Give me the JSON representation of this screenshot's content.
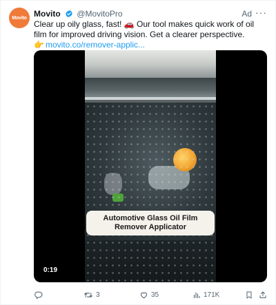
{
  "tweet": {
    "author_name": "Movito",
    "author_handle": "@MovitoPro",
    "avatar_text": "Movito",
    "ad_label": "Ad",
    "more_label": "···",
    "text_line": "Clear up oily glass, fast! 🚗 Our tool makes quick work of oil film for improved driving vision. Get a clearer perspective.",
    "link_pointer": "👉",
    "link_text": "movito.co/remover-applic..."
  },
  "media": {
    "caption": "Automotive Glass Oil Film Remover Applicator",
    "timestamp": "0:19"
  },
  "actions": {
    "replies": "",
    "retweets": "3",
    "likes": "35",
    "views": "171K"
  },
  "colors": {
    "accent": "#1d9bf0",
    "avatar": "#f07a3a",
    "muted": "#536471"
  },
  "icons": {
    "reply": "reply-icon",
    "retweet": "retweet-icon",
    "like": "heart-icon",
    "views": "views-chart-icon",
    "bookmark": "bookmark-icon",
    "share": "share-icon",
    "verified": "verified-badge-icon"
  }
}
